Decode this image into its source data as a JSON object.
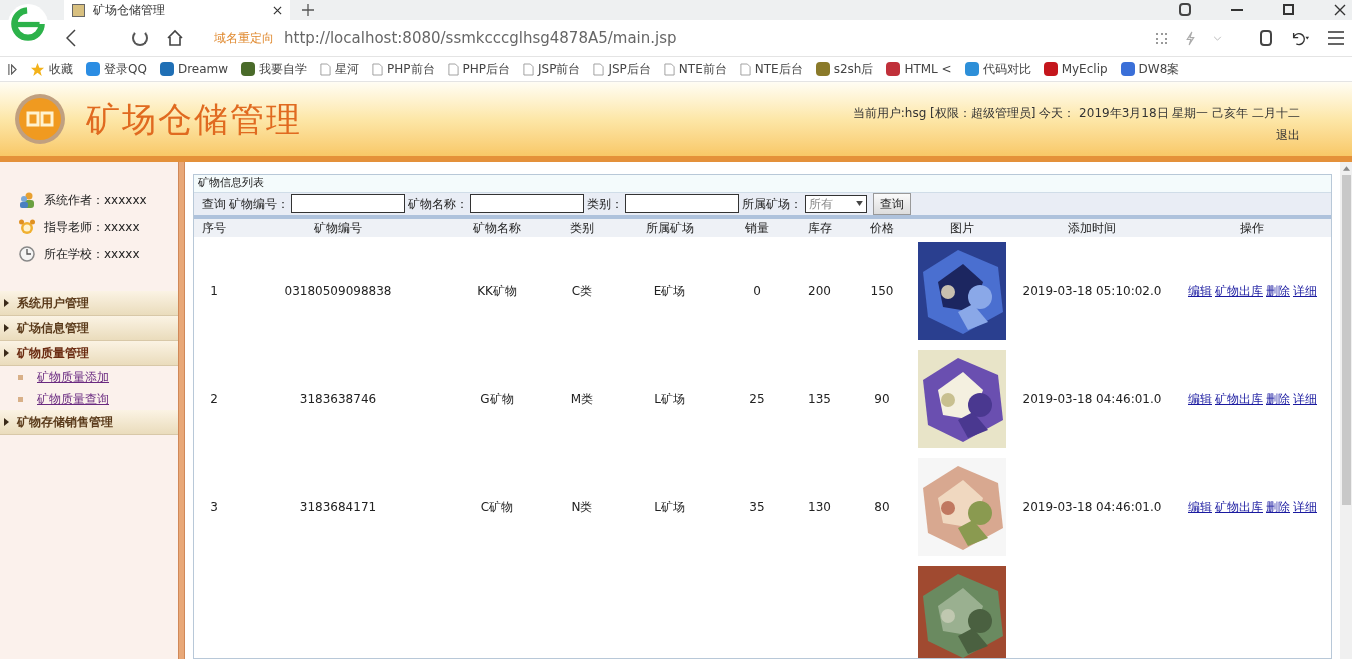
{
  "browser": {
    "tab_title": "矿场仓储管理",
    "redirect_label": "域名重定向",
    "url": "http://localhost:8080/ssmkcccglhsg4878A5/main.jsp",
    "bookmarks": [
      {
        "label": "收藏",
        "kind": "favorites"
      },
      {
        "label": "登录QQ",
        "kind": "site",
        "color": "#2b8de3"
      },
      {
        "label": "Dreamw",
        "kind": "site",
        "color": "#1f6fb5"
      },
      {
        "label": "我要自学",
        "kind": "site",
        "color": "#4a6b2a"
      },
      {
        "label": "星河",
        "kind": "page"
      },
      {
        "label": "PHP前台",
        "kind": "page"
      },
      {
        "label": "PHP后台",
        "kind": "page"
      },
      {
        "label": "JSP前台",
        "kind": "page"
      },
      {
        "label": "JSP后台",
        "kind": "page"
      },
      {
        "label": "NTE前台",
        "kind": "page"
      },
      {
        "label": "NTE后台",
        "kind": "page"
      },
      {
        "label": "s2sh后",
        "kind": "site",
        "color": "#8a7a2a"
      },
      {
        "label": "HTML <",
        "kind": "site",
        "color": "#c0303a"
      },
      {
        "label": "代码对比",
        "kind": "site",
        "color": "#2d8fd8"
      },
      {
        "label": "MyEclip",
        "kind": "site",
        "color": "#c4161c"
      },
      {
        "label": "DW8案",
        "kind": "site",
        "color": "#3a6fd8"
      }
    ]
  },
  "header": {
    "title": "矿场仓储管理",
    "user_info": "当前用户:hsg [权限：超级管理员] 今天： 2019年3月18日 星期一 己亥年 二月十二",
    "logout": "退出"
  },
  "sidebar": {
    "info": [
      {
        "kind": "author",
        "text": "系统作者：xxxxxx"
      },
      {
        "kind": "teacher",
        "text": "指导老师：xxxxx"
      },
      {
        "kind": "school",
        "text": "所在学校：xxxxx"
      }
    ],
    "menu": [
      {
        "label": "系统用户管理",
        "expanded": false
      },
      {
        "label": "矿场信息管理",
        "expanded": false
      },
      {
        "label": "矿物质量管理",
        "expanded": true,
        "children": [
          {
            "label": "矿物质量添加"
          },
          {
            "label": "矿物质量查询"
          }
        ]
      },
      {
        "label": "矿物存储销售管理",
        "expanded": false
      }
    ]
  },
  "panel": {
    "title": "矿物信息列表",
    "search": {
      "label": "查询",
      "fields": [
        {
          "label": "矿物编号："
        },
        {
          "label": "矿物名称："
        },
        {
          "label": "类别："
        }
      ],
      "select": {
        "label": "所属矿场：",
        "value": "所有"
      },
      "button": "查询"
    }
  },
  "table": {
    "columns": [
      "序号",
      "矿物编号",
      "矿物名称",
      "类别",
      "所属矿场",
      "销量",
      "库存",
      "价格",
      "图片",
      "添加时间",
      "操作"
    ],
    "rows": [
      {
        "kind": "full",
        "cells": [
          "1",
          "03180509098838",
          "KK矿物",
          "C类",
          "E矿场",
          "0",
          "200",
          "150"
        ],
        "time": "2019-03-18 05:10:02.0",
        "actions": [
          "编辑",
          "矿物出库",
          "删除",
          "详细"
        ]
      },
      {
        "kind": "full",
        "cells": [
          "2",
          "3183638746",
          "G矿物",
          "M类",
          "L矿场",
          "25",
          "135",
          "90"
        ],
        "time": "2019-03-18 04:46:01.0",
        "actions": [
          "编辑",
          "矿物出库",
          "删除",
          "详细"
        ]
      },
      {
        "kind": "full",
        "cells": [
          "3",
          "3183684171",
          "C矿物",
          "N类",
          "L矿场",
          "35",
          "130",
          "80"
        ],
        "time": "2019-03-18 04:46:01.0",
        "actions": [
          "编辑",
          "矿物出库",
          "删除",
          "详细"
        ]
      },
      {
        "kind": "partial"
      }
    ]
  }
}
